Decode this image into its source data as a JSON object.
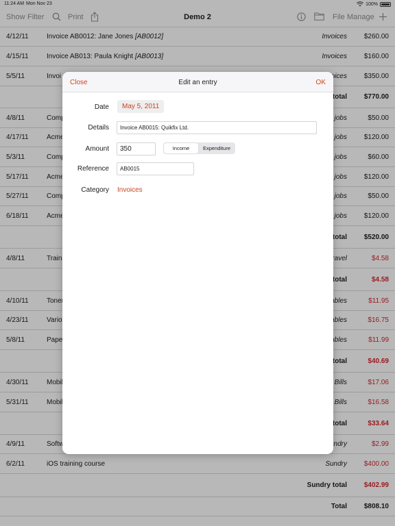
{
  "status_bar": {
    "time": "11:24 AM",
    "date": "Mon Nov 23",
    "battery": "100%"
  },
  "toolbar": {
    "show": "Show",
    "filter": "Filter",
    "print": "Print",
    "title": "Demo 2",
    "file": "File",
    "manage": "Manage"
  },
  "rows": [
    {
      "kind": "entry",
      "date": "4/12/11",
      "desc": "Invoice AB0012: Jane Jones",
      "ref": "[AB0012]",
      "cat": "Invoices",
      "amount": "$260.00"
    },
    {
      "kind": "entry",
      "date": "4/15/11",
      "desc": "Invoice AB013: Paula Knight",
      "ref": "[AB0013]",
      "cat": "Invoices",
      "amount": "$160.00"
    },
    {
      "kind": "entry",
      "date": "5/5/11",
      "desc": "Invoi",
      "ref": "",
      "cat": "oices",
      "amount": "$350.00"
    },
    {
      "kind": "subtotal",
      "label": "total",
      "amount": "$770.00"
    },
    {
      "kind": "entry",
      "date": "4/8/11",
      "desc": "Comp",
      "ref": "",
      "cat": "jobs",
      "amount": "$50.00"
    },
    {
      "kind": "entry",
      "date": "4/17/11",
      "desc": "Acme",
      "ref": "",
      "cat": "jobs",
      "amount": "$120.00"
    },
    {
      "kind": "entry",
      "date": "5/3/11",
      "desc": "Comp",
      "ref": "",
      "cat": "jobs",
      "amount": "$60.00"
    },
    {
      "kind": "entry",
      "date": "5/17/11",
      "desc": "Acme",
      "ref": "",
      "cat": "jobs",
      "amount": "$120.00"
    },
    {
      "kind": "entry",
      "date": "5/27/11",
      "desc": "Comp",
      "ref": "",
      "cat": "jobs",
      "amount": "$50.00"
    },
    {
      "kind": "entry",
      "date": "6/18/11",
      "desc": "Acme",
      "ref": "",
      "cat": "jobs",
      "amount": "$120.00"
    },
    {
      "kind": "subtotal",
      "label": "total",
      "amount": "$520.00"
    },
    {
      "kind": "entry",
      "date": "4/8/11",
      "desc": "Train",
      "ref": "",
      "cat": "ravel",
      "amount": "$4.58",
      "red": true
    },
    {
      "kind": "subtotal",
      "label": "total",
      "amount": "$4.58",
      "red": true
    },
    {
      "kind": "entry",
      "date": "4/10/11",
      "desc": "Toner",
      "ref": "",
      "cat": "ables",
      "amount": "$11.95",
      "red": true
    },
    {
      "kind": "entry",
      "date": "4/23/11",
      "desc": "Vario",
      "ref": "",
      "cat": "ables",
      "amount": "$16.75",
      "red": true
    },
    {
      "kind": "entry",
      "date": "5/8/11",
      "desc": "Pape",
      "ref": "",
      "cat": "ables",
      "amount": "$11.99",
      "red": true
    },
    {
      "kind": "subtotal",
      "label": "total",
      "amount": "$40.69",
      "red": true
    },
    {
      "kind": "entry",
      "date": "4/30/11",
      "desc": "Mobil",
      "ref": "",
      "cat": "Bills",
      "amount": "$17.06",
      "red": true
    },
    {
      "kind": "entry",
      "date": "5/31/11",
      "desc": "Mobil",
      "ref": "",
      "cat": "Bills",
      "amount": "$16.58",
      "red": true
    },
    {
      "kind": "subtotal",
      "label": "total",
      "amount": "$33.64",
      "red": true
    },
    {
      "kind": "entry",
      "date": "4/9/11",
      "desc": "Softw",
      "ref": "",
      "cat": "undry",
      "amount": "$2.99",
      "red": true
    },
    {
      "kind": "entry",
      "date": "6/2/11",
      "desc": "iOS training course",
      "ref": "",
      "cat": "Sundry",
      "amount": "$400.00",
      "red": true
    },
    {
      "kind": "subtotal",
      "label": "Sundry total",
      "amount": "$402.99",
      "red": true
    },
    {
      "kind": "subtotal",
      "label": "Total",
      "amount": "$808.10"
    }
  ],
  "modal": {
    "close": "Close",
    "title": "Edit an entry",
    "ok": "OK",
    "date_label": "Date",
    "date_value": "May 5, 2011",
    "details_label": "Details",
    "details_value": "Invoice AB0015: Quikfix Ltd.",
    "amount_label": "Amount",
    "amount_value": "350",
    "income": "Income",
    "expenditure": "Expenditure",
    "reference_label": "Reference",
    "reference_value": "AB0015",
    "category_label": "Category",
    "category_value": "Invoices"
  }
}
